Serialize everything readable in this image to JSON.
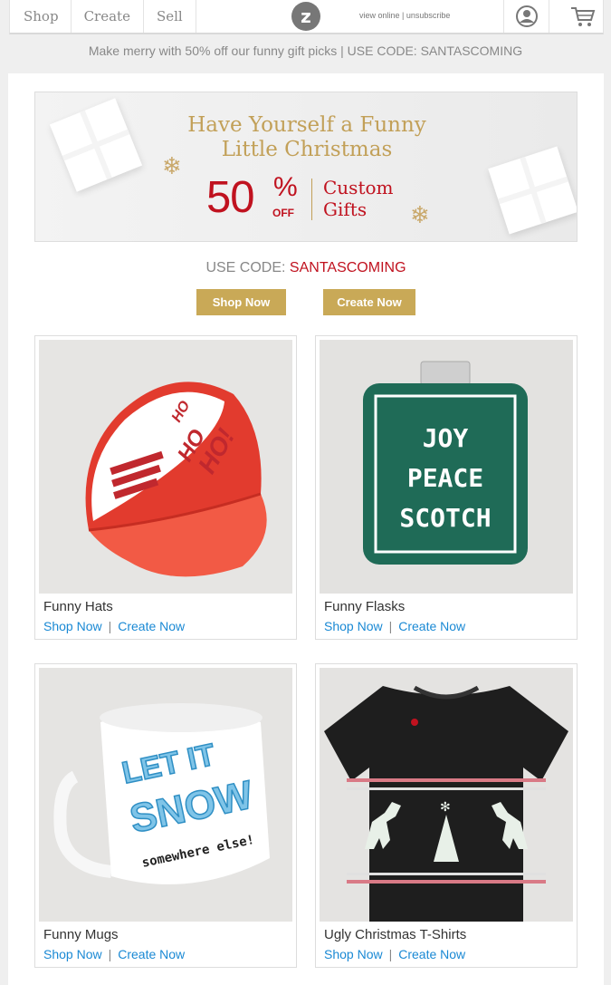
{
  "nav": {
    "items": [
      "Shop",
      "Create",
      "Sell"
    ],
    "logo": "z",
    "view_online": "view online",
    "separator": "|",
    "unsubscribe": "unsubscribe"
  },
  "promo_strip": "Make merry with 50% off our funny gift picks | USE CODE: SANTASCOMING",
  "hero": {
    "line1": "Have Yourself a Funny",
    "line2": "Little Christmas",
    "percent": "50",
    "percent_sign": "%",
    "off": "OFF",
    "custom_line1": "Custom",
    "custom_line2": "Gifts"
  },
  "code": {
    "label": "USE CODE:",
    "value": "SANTASCOMING"
  },
  "buttons": {
    "shop": "Shop Now",
    "create": "Create Now"
  },
  "products": [
    {
      "title": "Funny Hats",
      "shop": "Shop Now",
      "separator": "|",
      "create": "Create Now",
      "art": [
        "HO",
        "HO",
        "HO!"
      ]
    },
    {
      "title": "Funny Flasks",
      "shop": "Shop Now",
      "separator": "|",
      "create": "Create Now",
      "art": [
        "JOY",
        "PEACE",
        "SCOTCH"
      ]
    },
    {
      "title": "Funny Mugs",
      "shop": "Shop Now",
      "separator": "|",
      "create": "Create Now",
      "art": [
        "LET IT",
        "SNOW",
        "somewhere else!"
      ]
    },
    {
      "title": "Ugly Christmas T-Shirts",
      "shop": "Shop Now",
      "separator": "|",
      "create": "Create Now",
      "art": []
    }
  ],
  "colors": {
    "gold": "#c9a957",
    "red": "#c0121f",
    "link": "#1a89d4",
    "flask_green": "#1f6b57",
    "shirt": "#1e1e1e"
  }
}
